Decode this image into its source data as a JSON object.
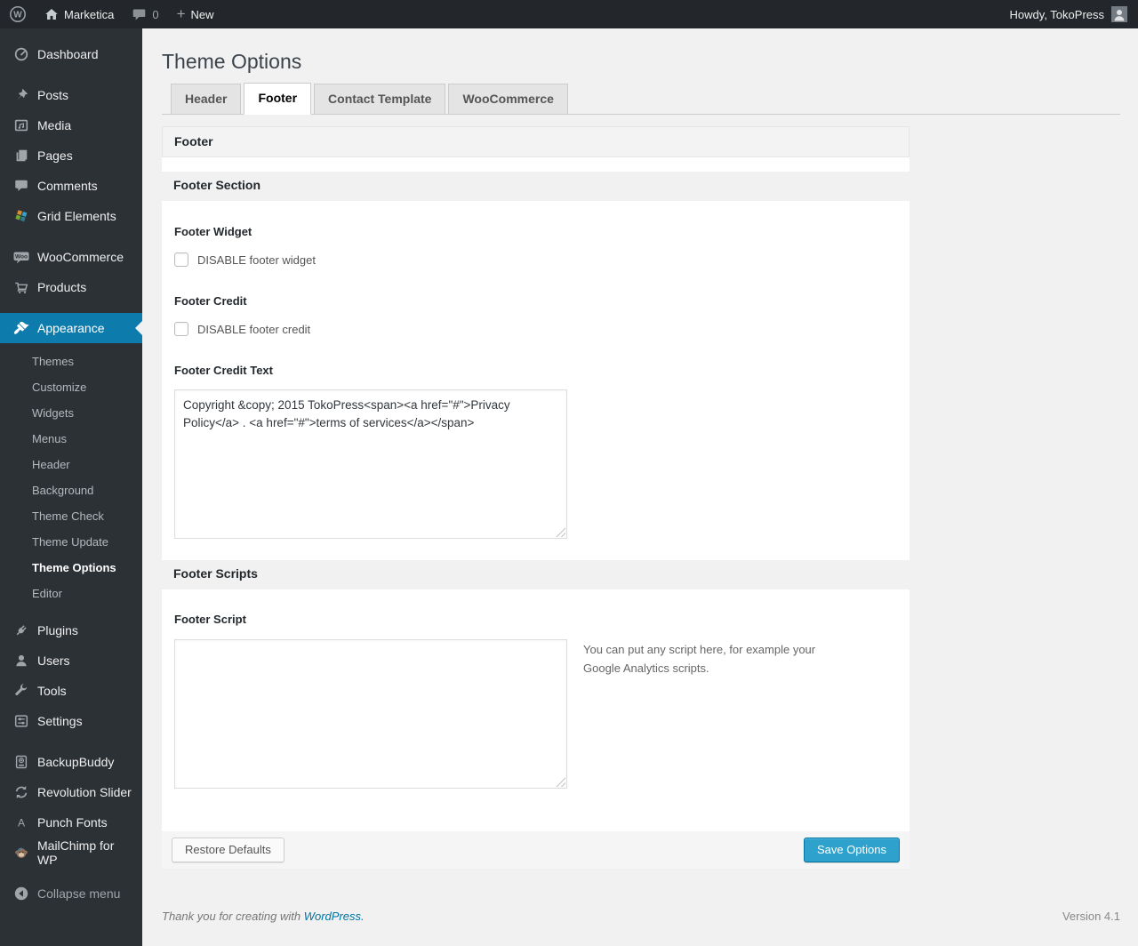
{
  "colors": {
    "accent": "#0074a2",
    "button_primary": "#2ea2cc",
    "menu_highlight": "#0d7cad",
    "admin_dark": "#23272b",
    "page_background": "#f1f1f1"
  },
  "admin_bar": {
    "site_name": "Marketica",
    "comments_count": "0",
    "new_label": "New",
    "howdy": "Howdy, TokoPress"
  },
  "sidebar": {
    "items": [
      {
        "label": "Dashboard",
        "icon": "dashboard-icon"
      },
      {
        "label": "Posts",
        "icon": "pushpin-icon"
      },
      {
        "label": "Media",
        "icon": "media-icon"
      },
      {
        "label": "Pages",
        "icon": "pages-icon"
      },
      {
        "label": "Comments",
        "icon": "comments-icon"
      },
      {
        "label": "Grid Elements",
        "icon": "grid-elements-icon"
      },
      {
        "label": "WooCommerce",
        "icon": "woocommerce-icon"
      },
      {
        "label": "Products",
        "icon": "cart-icon"
      },
      {
        "label": "Appearance",
        "icon": "appearance-brush-icon",
        "active": true
      },
      {
        "label": "Plugins",
        "icon": "plugin-icon"
      },
      {
        "label": "Users",
        "icon": "user-icon"
      },
      {
        "label": "Tools",
        "icon": "wrench-icon"
      },
      {
        "label": "Settings",
        "icon": "settings-sliders-icon"
      },
      {
        "label": "BackupBuddy",
        "icon": "backup-drive-icon"
      },
      {
        "label": "Revolution Slider",
        "icon": "cycle-arrows-icon"
      },
      {
        "label": "Punch Fonts",
        "icon": "letter-a-icon"
      },
      {
        "label": "MailChimp for WP",
        "icon": "mailchimp-monkey-icon"
      }
    ],
    "appearance_submenu": {
      "items": [
        {
          "label": "Themes"
        },
        {
          "label": "Customize"
        },
        {
          "label": "Widgets"
        },
        {
          "label": "Menus"
        },
        {
          "label": "Header"
        },
        {
          "label": "Background"
        },
        {
          "label": "Theme Check"
        },
        {
          "label": "Theme Update"
        },
        {
          "label": "Theme Options",
          "current": true
        },
        {
          "label": "Editor"
        }
      ]
    },
    "collapse_label": "Collapse menu"
  },
  "page": {
    "title": "Theme Options",
    "tabs": [
      {
        "label": "Header",
        "active": false
      },
      {
        "label": "Footer",
        "active": true
      },
      {
        "label": "Contact Template",
        "active": false
      },
      {
        "label": "WooCommerce",
        "active": false
      }
    ]
  },
  "panel": {
    "box_title": "Footer",
    "footer_section": {
      "title": "Footer Section",
      "footer_widget_label": "Footer Widget",
      "footer_widget_checkbox": "DISABLE footer widget",
      "footer_widget_checked": false,
      "footer_credit_label": "Footer Credit",
      "footer_credit_checkbox": "DISABLE footer credit",
      "footer_credit_checked": false,
      "footer_credit_text_label": "Footer Credit Text",
      "footer_credit_text_value": "Copyright &copy; 2015 TokoPress<span><a href=\"#\">Privacy Policy</a> . <a href=\"#\">terms of services</a></span>"
    },
    "footer_scripts": {
      "title": "Footer Scripts",
      "footer_script_label": "Footer Script",
      "footer_script_value": "",
      "footer_script_help": "You can put any script here, for example your Google Analytics scripts."
    },
    "actions": {
      "restore_label": "Restore Defaults",
      "save_label": "Save Options"
    }
  },
  "page_footer": {
    "thanks_prefix": "Thank you for creating with ",
    "wordpress_link": "WordPress.",
    "version": "Version 4.1"
  }
}
